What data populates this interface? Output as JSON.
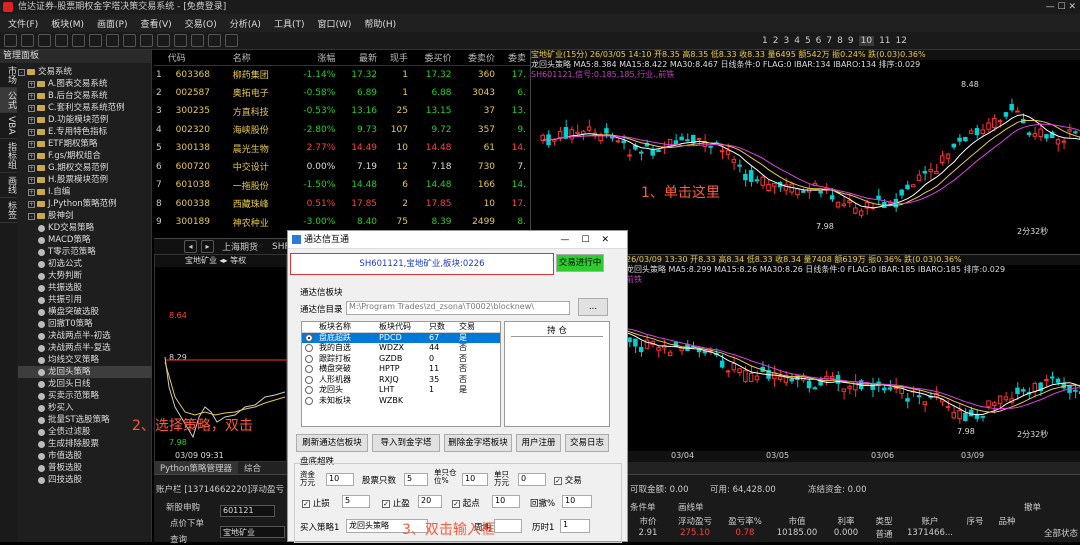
{
  "window": {
    "title": "信达证券-股票期权金字塔决策交易系统 - [免费登录]"
  },
  "menu": [
    "文件(F)",
    "板块(M)",
    "画面(P)",
    "查看(V)",
    "交易(O)",
    "分析(A)",
    "工具(T)",
    "窗口(W)",
    "帮助(H)"
  ],
  "toolbar": {
    "numbers": [
      "1",
      "2",
      "3",
      "4",
      "5",
      "6",
      "7",
      "8",
      "9",
      "10",
      "11",
      "12"
    ],
    "selected": "10"
  },
  "sidebar": {
    "title": "管理面板",
    "vtabs": [
      "市场",
      "公式",
      "VBA",
      "指标组",
      "画线",
      "标签"
    ],
    "tree": [
      {
        "label": "交易系统",
        "level": 0,
        "kind": "folder",
        "exp": "-"
      },
      {
        "label": "A.图表交易系统",
        "level": 1,
        "kind": "folder",
        "exp": "+"
      },
      {
        "label": "B.后台交易系统",
        "level": 1,
        "kind": "folder",
        "exp": "+"
      },
      {
        "label": "C.套利交易系统范例",
        "level": 1,
        "kind": "folder",
        "exp": "+"
      },
      {
        "label": "D.功能模块范例",
        "level": 1,
        "kind": "folder",
        "exp": "+"
      },
      {
        "label": "E.专用特色指标",
        "level": 1,
        "kind": "folder",
        "exp": "+"
      },
      {
        "label": "ETF期权策略",
        "level": 1,
        "kind": "folder",
        "exp": "+"
      },
      {
        "label": "F.gs/期权组合",
        "level": 1,
        "kind": "folder",
        "exp": "+"
      },
      {
        "label": "G.期权交易范例",
        "level": 1,
        "kind": "folder",
        "exp": "+"
      },
      {
        "label": "H.股票模块范例",
        "level": 1,
        "kind": "folder",
        "exp": "+"
      },
      {
        "label": "I.自编",
        "level": 1,
        "kind": "folder",
        "exp": "+"
      },
      {
        "label": "J.Python策略范例",
        "level": 1,
        "kind": "folder",
        "exp": "+"
      },
      {
        "label": "股神剑",
        "level": 1,
        "kind": "folder",
        "exp": "-"
      },
      {
        "label": "KD交易策略",
        "level": 2,
        "kind": "leaf"
      },
      {
        "label": "MACD策略",
        "level": 2,
        "kind": "leaf"
      },
      {
        "label": "T零示范策略",
        "level": 2,
        "kind": "leaf"
      },
      {
        "label": "初选公式",
        "level": 2,
        "kind": "leaf"
      },
      {
        "label": "大势判断",
        "level": 2,
        "kind": "leaf"
      },
      {
        "label": "共振选股",
        "level": 2,
        "kind": "leaf"
      },
      {
        "label": "共振引用",
        "level": 2,
        "kind": "leaf"
      },
      {
        "label": "横盘突破选股",
        "level": 2,
        "kind": "leaf"
      },
      {
        "label": "回撤T0策略",
        "level": 2,
        "kind": "leaf"
      },
      {
        "label": "决战两点半-初选",
        "level": 2,
        "kind": "leaf"
      },
      {
        "label": "决战两点半-复选",
        "level": 2,
        "kind": "leaf"
      },
      {
        "label": "均线交叉策略",
        "level": 2,
        "kind": "leaf"
      },
      {
        "label": "龙回头策略",
        "level": 2,
        "kind": "leaf",
        "selected": true
      },
      {
        "label": "龙回头日线",
        "level": 2,
        "kind": "leaf"
      },
      {
        "label": "买卖示范策略",
        "level": 2,
        "kind": "leaf"
      },
      {
        "label": "秒买入",
        "level": 2,
        "kind": "leaf"
      },
      {
        "label": "批量ST选股策略",
        "level": 2,
        "kind": "leaf"
      },
      {
        "label": "全债过滤股",
        "level": 2,
        "kind": "leaf"
      },
      {
        "label": "生成排除股票",
        "level": 2,
        "kind": "leaf"
      },
      {
        "label": "市值选股",
        "level": 2,
        "kind": "leaf"
      },
      {
        "label": "普板选股",
        "level": 2,
        "kind": "leaf"
      },
      {
        "label": "四技选股",
        "level": 2,
        "kind": "leaf"
      }
    ]
  },
  "stocks": {
    "headers": [
      "",
      "代码",
      "名称",
      "涨幅",
      "最新",
      "现手",
      "委买价",
      "委卖价",
      "委卖"
    ],
    "rows": [
      [
        "1",
        "603368",
        "柳药集团",
        "-1.14%",
        "17.32",
        "1",
        "17.32",
        "360",
        "17."
      ],
      [
        "2",
        "002587",
        "奥拓电子",
        "-0.58%",
        "6.89",
        "1",
        "6.88",
        "3043",
        "6."
      ],
      [
        "3",
        "300235",
        "方直科技",
        "-0.53%",
        "13.16",
        "25",
        "13.15",
        "37",
        "13."
      ],
      [
        "4",
        "002320",
        "海峡股份",
        "-2.80%",
        "9.73",
        "107",
        "9.72",
        "357",
        "9."
      ],
      [
        "5",
        "300138",
        "晨光生物",
        "2.77%",
        "14.49",
        "10",
        "14.48",
        "61",
        "14."
      ],
      [
        "6",
        "600720",
        "中交设计",
        "0.00%",
        "7.19",
        "12",
        "7.18",
        "730",
        "7."
      ],
      [
        "7",
        "601038",
        "一拖股份",
        "-1.50%",
        "14.48",
        "6",
        "14.48",
        "166",
        "14."
      ],
      [
        "8",
        "600338",
        "西藏珠峰",
        "0.51%",
        "17.85",
        "2",
        "17.85",
        "10",
        "17."
      ],
      [
        "9",
        "300189",
        "神农种业",
        "-3.00%",
        "8.40",
        "75",
        "8.39",
        "2499",
        "8."
      ]
    ]
  },
  "market_tabs": [
    "上海期货",
    "SHFE",
    "红"
  ],
  "left_chart": {
    "name": "宝地矿业",
    "period": "等权",
    "prices": [
      "8.64",
      "8.29",
      "7.98"
    ],
    "date": "03/09 09:31"
  },
  "chart_top": {
    "header": "宝地矿业(15分) 26/03/05 14:10 开8.35 高8.35 低8.33 收8.33 量6495 额542万 振0.24% 跌(0.03)0.36%",
    "ma": "龙回头策略 MA5:8.384 MA15:8.422 MA30:8.467 日线条件:0 FLAG:0 IBAR:134 IBARO:134 排序:0.029",
    "signal": "SH601121,信号:0.185,185,行业.,前铁",
    "hi": "8.48",
    "lo": "7.98",
    "ann": "1、单击这里",
    "countdown": "2分32秒"
  },
  "chart_bot": {
    "header": "26/03/09 13:30 开8.33 高8.34 低8.33 收8.34 量7408 额619万 振0.36% 跌(0.03)0.36%",
    "ma": "龙回头策略 MA5:8.299 MA15:8.26 MA30:8.26 日线条件:0 FLAG:0 IBAR:185 IBARO:185 排序:0.029",
    "signal": "前铁",
    "lo": "7.98",
    "countdown": "2分32秒",
    "dates": [
      "03/04",
      "03/05",
      "03/06",
      "03/09"
    ]
  },
  "dialog": {
    "title": "通达信互通",
    "info": "SH601121,宝地矿业,板块:0226",
    "run_btn": "交易进行中",
    "group1": "通达信板块",
    "dir_label": "通达信目录",
    "dir_value": "M:\\Program Trades\\zd_zsona\\T0002\\blocknew\\",
    "browse": "...",
    "cols": [
      "板块名称",
      "板块代码",
      "只数",
      "交易"
    ],
    "blocks": [
      [
        "盘底超跌",
        "PDCD",
        "67",
        "是"
      ],
      [
        "我的自选",
        "WDZX",
        "44",
        "否"
      ],
      [
        "跟踪打板",
        "GZDB",
        "0",
        "否"
      ],
      [
        "横盘突破",
        "HPTP",
        "11",
        "否"
      ],
      [
        "人形机器",
        "RXJQ",
        "35",
        "否"
      ],
      [
        "龙回头",
        "LHT",
        "1",
        "是"
      ],
      [
        "未知板块",
        "WZBK",
        "",
        ""
      ]
    ],
    "holding": "持  仓",
    "buttons": [
      "刷新通达信板块",
      "导入到金字塔",
      "删除金字塔板块",
      "用户注册",
      "交易日志"
    ],
    "group2": "盘底超跌",
    "p1": "资金万元",
    "p1v": "10",
    "p2": "股票只数",
    "p2v": "5",
    "p3": "单只仓位%",
    "p3v": "10",
    "p4": "单只万元",
    "p4v": "0",
    "p5": "交易",
    "stop": "止损",
    "stopv": "5",
    "tp": "止盈",
    "tpv": "20",
    "start": "起点",
    "startv": "10",
    "pull": "回撤%",
    "pullv": "10",
    "buy_label": "买入策略1",
    "buy_value": "龙回头策略",
    "period": "周期",
    "hist": "历时1",
    "histv": "1"
  },
  "annotations": {
    "a2": "2、选择策略，双击",
    "a3": "3、双击输入框"
  },
  "bottom": {
    "tabs": [
      "Python策略管理器",
      "综合"
    ],
    "account": "账户栏 [13714662220]",
    "float": "浮动盈亏",
    "stock_label": "宝地矿业",
    "code": "601121",
    "new_buy": "新股申购",
    "order": "点价下单",
    "search": "查询",
    "can": "可取金额: 0.00",
    "total": "可用: 64,428.00",
    "frozen": "冻结资金: 0.00",
    "withdraw": "撤单",
    "all": "全部撤单",
    "cond": "条件单",
    "radar": "画线单",
    "status": "全部状态",
    "heads": [
      "市价",
      "浮动盈亏",
      "盈亏率%",
      "市值",
      "利率",
      "类型",
      "账户",
      "序号",
      "品种"
    ],
    "row": [
      "2.91",
      "275.10",
      "0.78",
      "10185.00",
      "0.000",
      "普通",
      "1371466...",
      "",
      ""
    ]
  }
}
